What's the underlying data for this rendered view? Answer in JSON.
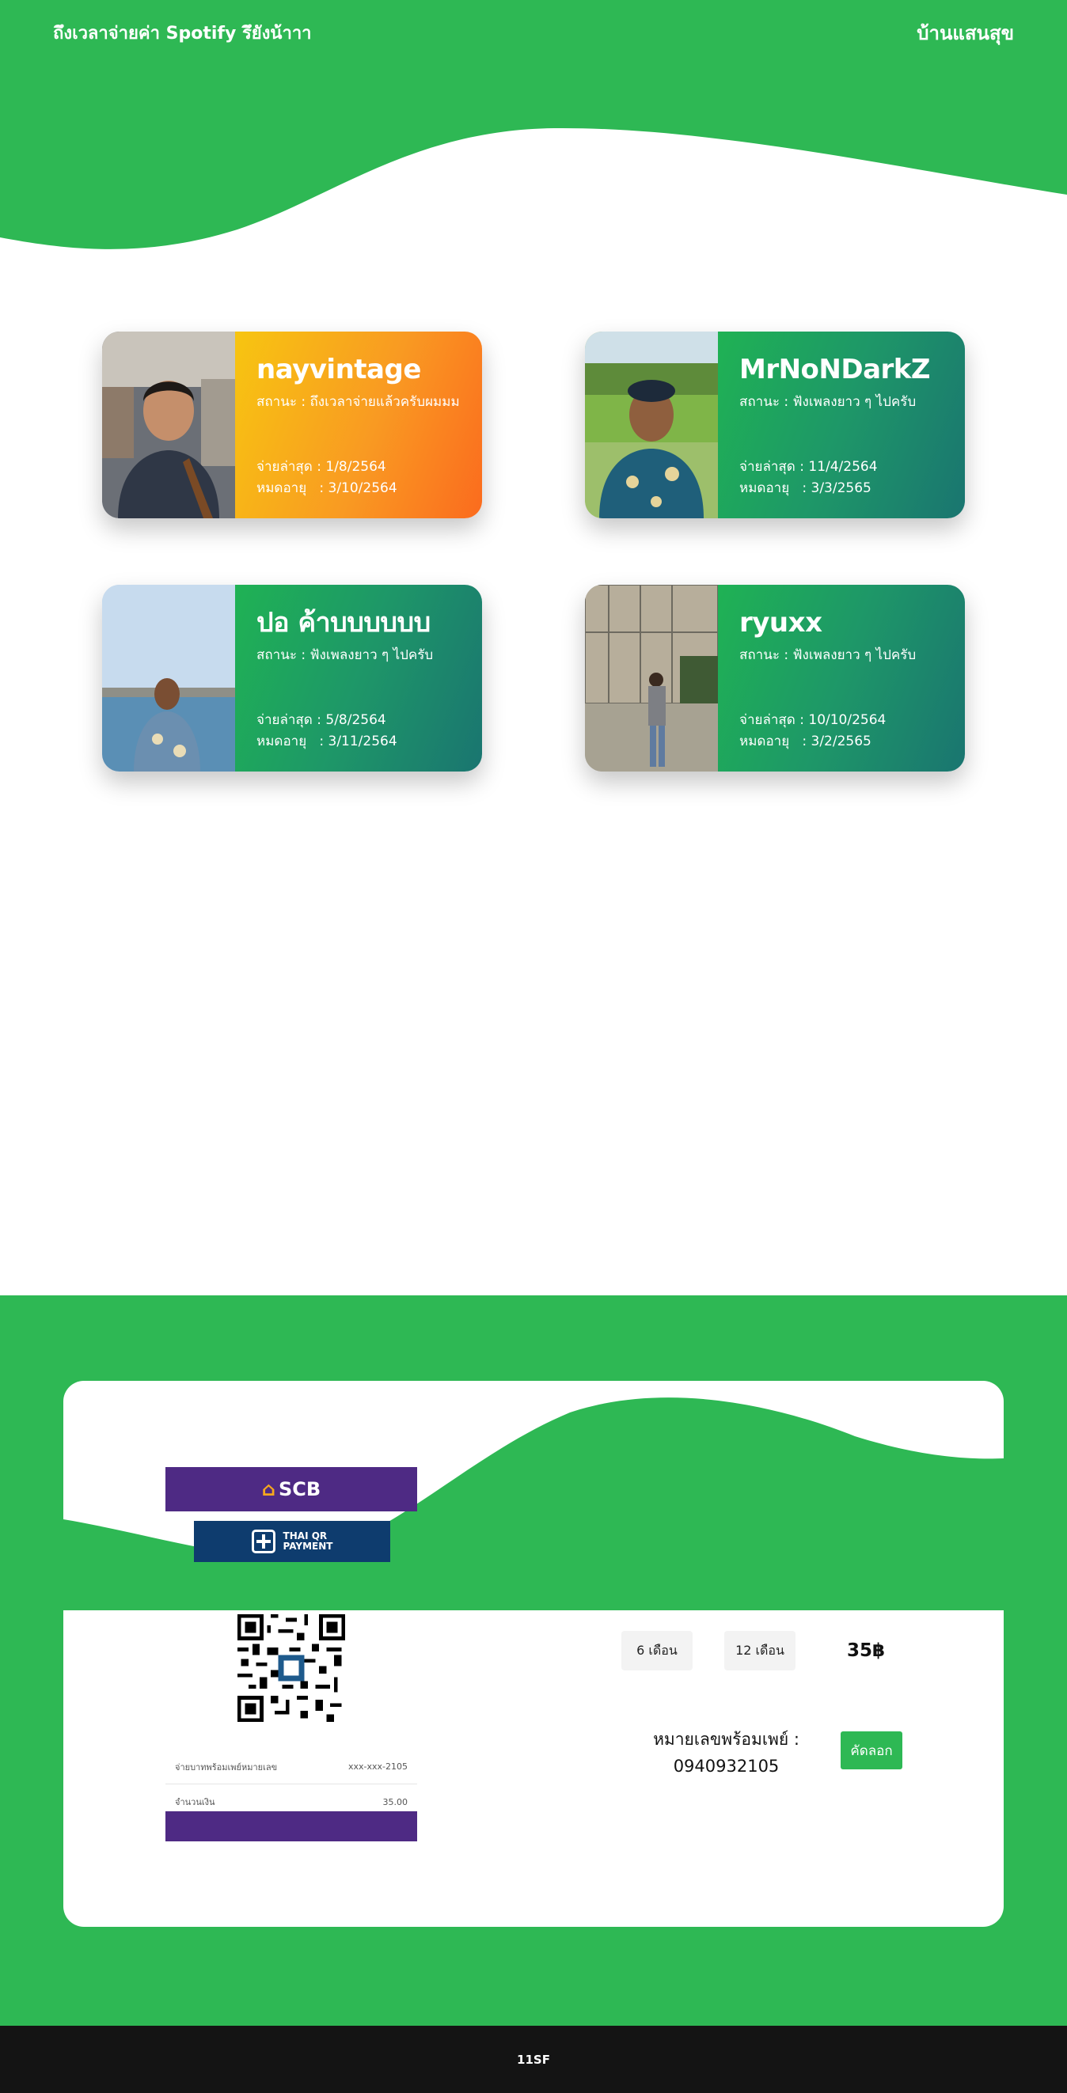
{
  "header": {
    "brand": "ถึงเวลาจ่ายค่า Spotify รึยังน้าาา",
    "nav_link": "บ้านแสนสุข"
  },
  "members": [
    {
      "name": "nayvintage",
      "status": "สถานะ : ถึงเวลาจ่ายแล้วครับผมมม",
      "last_paid": "จ่ายล่าสุด : 1/8/2564",
      "expires": "หมดอายุ   : 3/10/2564",
      "theme": "orange"
    },
    {
      "name": "MrNoNDarkZ",
      "status": "สถานะ : ฟังเพลงยาว ๆ ไปครับ",
      "last_paid": "จ่ายล่าสุด : 11/4/2564",
      "expires": "หมดอายุ   : 3/3/2565",
      "theme": "green"
    },
    {
      "name": "ปอ ค้าบบบบบบ",
      "status": "สถานะ : ฟังเพลงยาว ๆ ไปครับ",
      "last_paid": "จ่ายล่าสุด : 5/8/2564",
      "expires": "หมดอายุ   : 3/11/2564",
      "theme": "green"
    },
    {
      "name": "ryuxx",
      "status": "สถานะ : ฟังเพลงยาว ๆ ไปครับ",
      "last_paid": "จ่ายล่าสุด : 10/10/2564",
      "expires": "หมดอายุ   : 3/2/2565",
      "theme": "green"
    }
  ],
  "payment": {
    "bank_logo": "SCB",
    "qr_badge_line1": "THAI QR",
    "qr_badge_line2": "PAYMENT",
    "slip_rows": [
      {
        "label": "จ่ายบาทพร้อมเพย์หมายเลข",
        "value": "xxx-xxx-2105"
      },
      {
        "label": "จำนวนเงิน",
        "value": "35.00"
      }
    ],
    "plan_6": "6 เดือน",
    "plan_12": "12 เดือน",
    "price": "35฿",
    "promptpay_label": "หมายเลขพร้อมเพย์ :",
    "promptpay_number": "0940932105",
    "copy_label": "คัดลอก"
  },
  "colors": {
    "brand_green": "#2eb854",
    "card_orange_start": "#f7c511",
    "card_orange_end": "#fb6b1e",
    "card_green_end": "#1a7570",
    "scb_purple": "#4e2a84",
    "footer_bg": "#141414"
  },
  "footer": {
    "text": "11SF"
  }
}
